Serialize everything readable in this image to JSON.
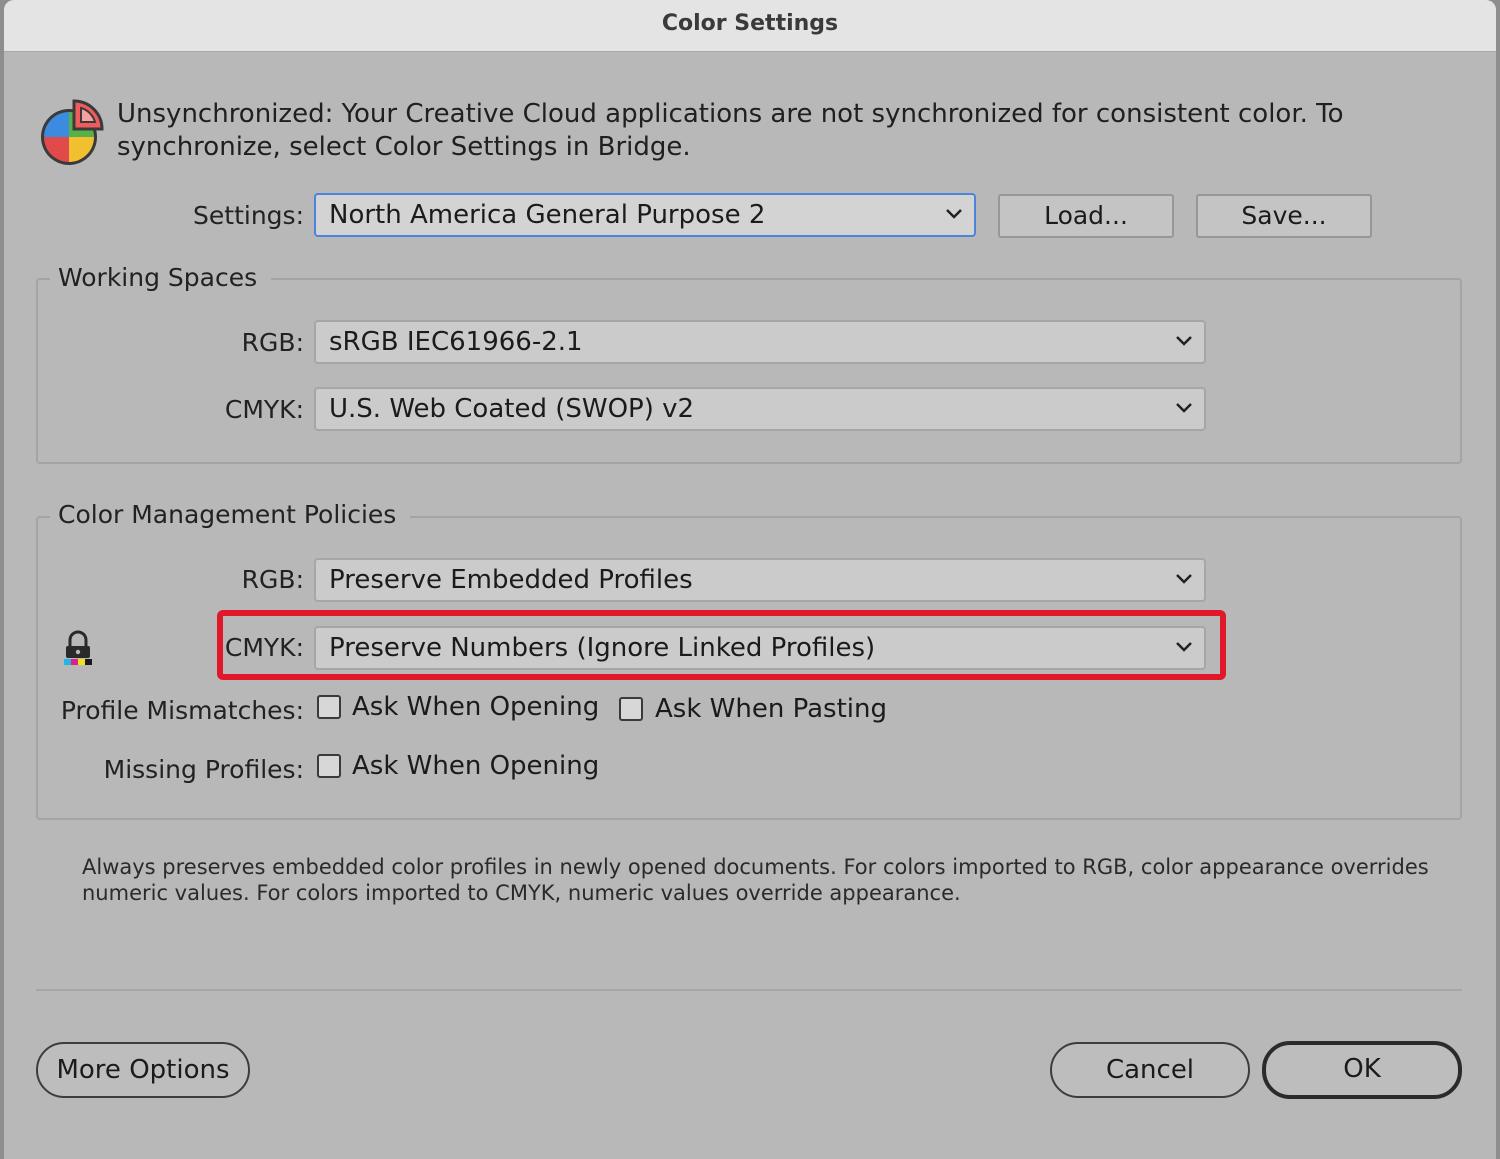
{
  "window": {
    "title": "Color Settings"
  },
  "sync": {
    "icon": "creative-cloud-color-wheel-icon",
    "message": "Unsynchronized: Your Creative Cloud applications are not synchronized for consistent color. To synchronize, select Color Settings in Bridge."
  },
  "settings": {
    "label": "Settings:",
    "value": "North America General Purpose 2",
    "load_label": "Load...",
    "save_label": "Save..."
  },
  "working_spaces": {
    "legend": "Working Spaces",
    "rgb_label": "RGB:",
    "rgb_value": "sRGB IEC61966-2.1",
    "cmyk_label": "CMYK:",
    "cmyk_value": "U.S. Web Coated (SWOP) v2"
  },
  "policies": {
    "legend": "Color Management Policies",
    "rgb_label": "RGB:",
    "rgb_value": "Preserve Embedded Profiles",
    "cmyk_label": "CMYK:",
    "cmyk_value": "Preserve Numbers (Ignore Linked Profiles)",
    "profile_mismatches_label": "Profile Mismatches:",
    "mismatch_opening_label": "Ask When Opening",
    "mismatch_opening_checked": false,
    "mismatch_pasting_label": "Ask When Pasting",
    "mismatch_pasting_checked": false,
    "missing_profiles_label": "Missing Profiles:",
    "missing_opening_label": "Ask When Opening",
    "missing_opening_checked": false
  },
  "description": "Always preserves embedded color profiles in newly opened documents. For colors imported to RGB, color appearance overrides numeric values. For colors imported to CMYK, numeric values override appearance.",
  "footer": {
    "more_options_label": "More Options",
    "cancel_label": "Cancel",
    "ok_label": "OK"
  },
  "colors": {
    "highlight": "#e0182a",
    "focus_ring": "#4c84dc",
    "dialog_bg": "#b8b8b8"
  }
}
